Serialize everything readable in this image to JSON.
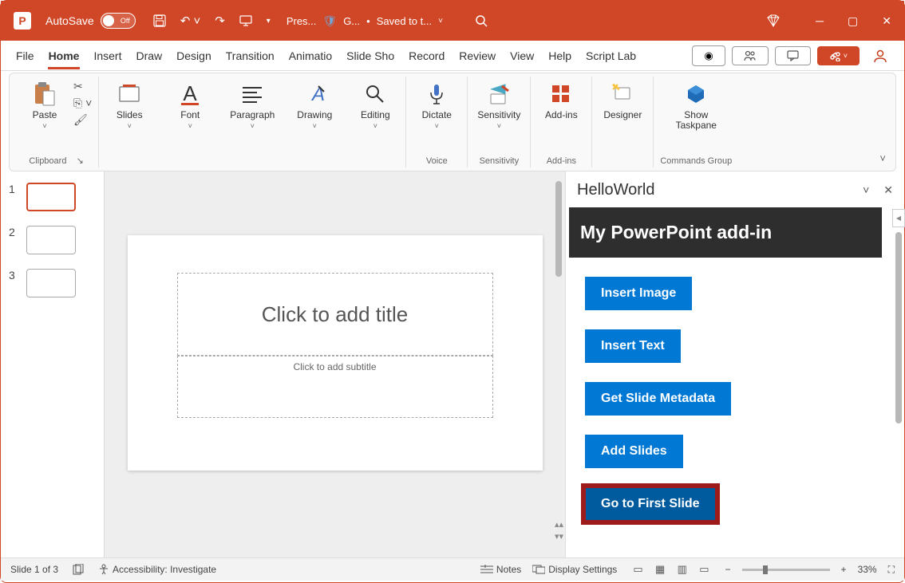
{
  "titlebar": {
    "autosave_label": "AutoSave",
    "autosave_state": "Off",
    "filename": "Pres...",
    "sensitivity": "G...",
    "saved_status": "Saved to t..."
  },
  "tabs": {
    "items": [
      "File",
      "Home",
      "Insert",
      "Draw",
      "Design",
      "Transition",
      "Animatio",
      "Slide Sho",
      "Record",
      "Review",
      "View",
      "Help",
      "Script Lab"
    ],
    "active_index": 1
  },
  "ribbon": {
    "clipboard": {
      "paste": "Paste",
      "group": "Clipboard"
    },
    "slides": {
      "label": "Slides"
    },
    "font": {
      "label": "Font"
    },
    "paragraph": {
      "label": "Paragraph"
    },
    "drawing": {
      "label": "Drawing"
    },
    "editing": {
      "label": "Editing"
    },
    "dictate": {
      "label": "Dictate",
      "group": "Voice"
    },
    "sensitivity": {
      "label": "Sensitivity",
      "group": "Sensitivity"
    },
    "addins": {
      "label": "Add-ins",
      "group": "Add-ins"
    },
    "designer": {
      "label": "Designer"
    },
    "show_taskpane": {
      "label": "Show\nTaskpane",
      "group": "Commands Group"
    }
  },
  "thumbs": {
    "numbers": [
      "1",
      "2",
      "3"
    ],
    "selected": 0
  },
  "slide": {
    "title_placeholder": "Click to add title",
    "subtitle_placeholder": "Click to add subtitle"
  },
  "taskpane": {
    "title": "HelloWorld",
    "addin_header": "My PowerPoint add-in",
    "buttons": [
      "Insert Image",
      "Insert Text",
      "Get Slide Metadata",
      "Add Slides",
      "Go to First Slide"
    ],
    "highlighted_index": 4
  },
  "statusbar": {
    "slide_info": "Slide 1 of 3",
    "accessibility": "Accessibility: Investigate",
    "notes": "Notes",
    "display": "Display Settings",
    "zoom": "33%"
  }
}
